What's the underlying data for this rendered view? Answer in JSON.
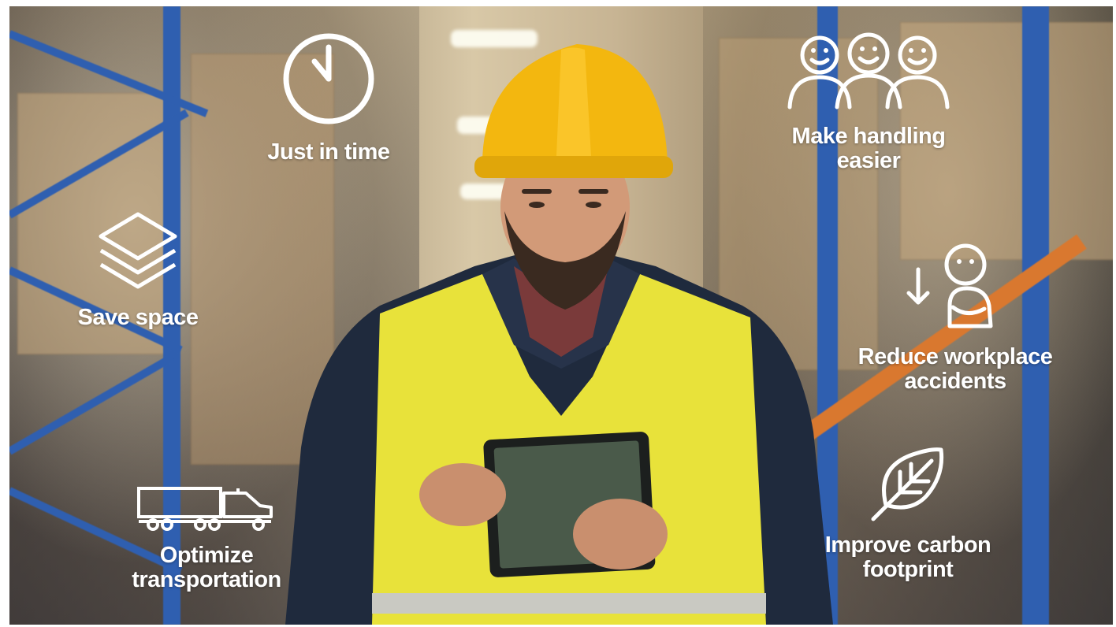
{
  "overlays": {
    "just_in_time": {
      "label": "Just in time",
      "icon": "clock-icon"
    },
    "save_space": {
      "label": "Save space",
      "icon": "layers-icon"
    },
    "optimize_transportation": {
      "line1": "Optimize",
      "line2": "transportation",
      "icon": "truck-icon"
    },
    "make_handling_easier": {
      "line1": "Make handling",
      "line2": "easier",
      "icon": "people-icon"
    },
    "reduce_workplace_accidents": {
      "line1": "Reduce workplace",
      "line2": "accidents",
      "icon": "injured-person-icon"
    },
    "improve_carbon_footprint": {
      "line1": "Improve carbon",
      "line2": "footprint",
      "icon": "leaf-icon"
    }
  },
  "colors": {
    "helmet": "#f3b70f",
    "vest": "#e8e23a",
    "jacket": "#1f2a3d",
    "rack_blue": "#2f5fb0",
    "rack_orange": "#d9782f",
    "overlay_text": "#ffffff"
  }
}
